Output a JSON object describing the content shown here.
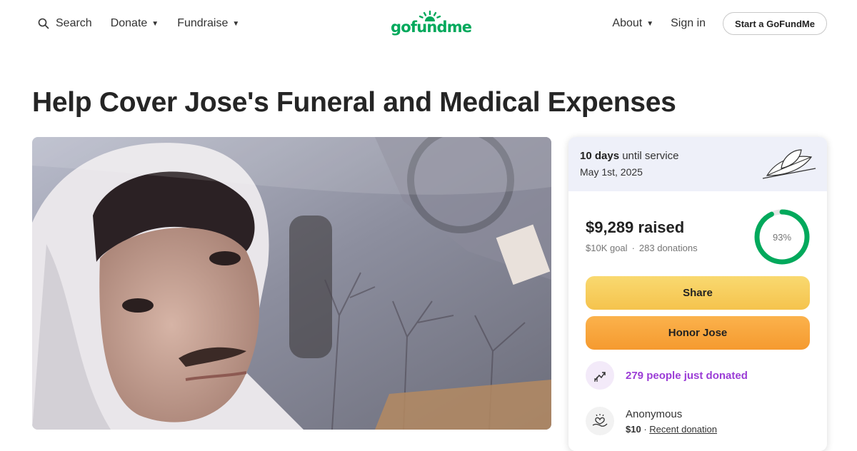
{
  "nav": {
    "search_label": "Search",
    "donate_label": "Donate",
    "fundraise_label": "Fundraise",
    "about_label": "About",
    "signin_label": "Sign in",
    "start_label": "Start a GoFundMe",
    "logo_text": "gofundme"
  },
  "campaign": {
    "title": "Help Cover Jose's Funeral and Medical Expenses"
  },
  "card": {
    "days_count": "10 days",
    "days_suffix": "until service",
    "service_date": "May 1st, 2025",
    "raised": "$9,289 raised",
    "goal": "$10K goal",
    "donations": "283 donations",
    "progress_label": "93%",
    "progress_fraction": 0.93,
    "share_label": "Share",
    "honor_label": "Honor Jose",
    "recent_count_text": "279 people just donated",
    "donor_name": "Anonymous",
    "donor_amount": "$10",
    "donor_sep": "·",
    "donor_tag": "Recent donation"
  },
  "colors": {
    "brand_green": "#02a95c",
    "share_yellow": "#f7cd5a",
    "honor_orange": "#f8a43c",
    "recent_purple": "#9b3dd6"
  },
  "icons": [
    "search-icon",
    "caret-down-icon",
    "leaf-icon",
    "trend-up-icon",
    "hand-heart-icon"
  ]
}
